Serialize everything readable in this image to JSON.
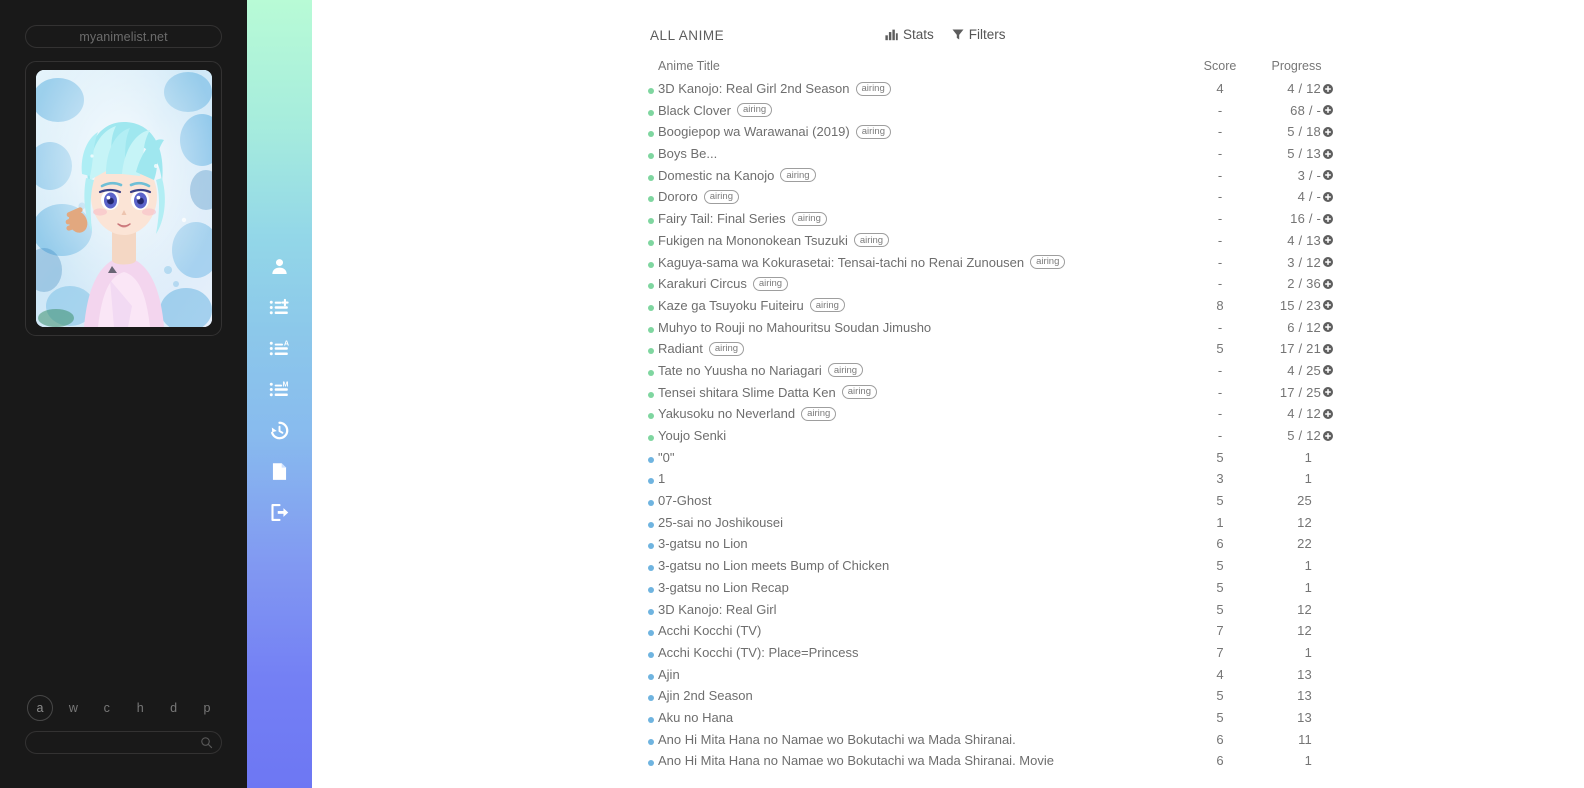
{
  "left": {
    "site_label": "myanimelist.net",
    "avatar_name": "anime-avatar-illustration",
    "letters": [
      {
        "key": "a",
        "label": "a",
        "active": true
      },
      {
        "key": "w",
        "label": "w",
        "active": false
      },
      {
        "key": "c",
        "label": "c",
        "active": false
      },
      {
        "key": "h",
        "label": "h",
        "active": false
      },
      {
        "key": "d",
        "label": "d",
        "active": false
      },
      {
        "key": "p",
        "label": "p",
        "active": false
      }
    ],
    "search": {
      "value": "",
      "placeholder": ""
    }
  },
  "rail": {
    "items": [
      {
        "icon": "user-icon"
      },
      {
        "icon": "list-add-icon"
      },
      {
        "icon": "list-anime-icon"
      },
      {
        "icon": "list-manga-icon"
      },
      {
        "icon": "history-icon"
      },
      {
        "icon": "document-icon"
      },
      {
        "icon": "logout-icon"
      }
    ]
  },
  "main": {
    "list_title": "ALL ANIME",
    "stats_label": "Stats",
    "filters_label": "Filters",
    "columns": {
      "title": "Anime Title",
      "score": "Score",
      "progress": "Progress"
    },
    "colors": {
      "watching_dot": "#7fd6a0",
      "completed_dot": "#6fb4e0",
      "gradient_start": "#b8fbd6",
      "gradient_end": "#6d77f3",
      "page_background": "#191919",
      "content_background": "#ffffff"
    },
    "rows": [
      {
        "status": "watching",
        "title": "3D Kanojo: Real Girl 2nd Season",
        "badge": "airing",
        "score": "4",
        "progress": "4 / 12",
        "increment": true
      },
      {
        "status": "watching",
        "title": "Black Clover",
        "badge": "airing",
        "score": "-",
        "progress": "68 / -",
        "increment": true
      },
      {
        "status": "watching",
        "title": "Boogiepop wa Warawanai (2019)",
        "badge": "airing",
        "score": "-",
        "progress": "5 / 18",
        "increment": true
      },
      {
        "status": "watching",
        "title": "Boys Be...",
        "badge": "",
        "score": "-",
        "progress": "5 / 13",
        "increment": true
      },
      {
        "status": "watching",
        "title": "Domestic na Kanojo",
        "badge": "airing",
        "score": "-",
        "progress": "3 / -",
        "increment": true
      },
      {
        "status": "watching",
        "title": "Dororo",
        "badge": "airing",
        "score": "-",
        "progress": "4 / -",
        "increment": true
      },
      {
        "status": "watching",
        "title": "Fairy Tail: Final Series",
        "badge": "airing",
        "score": "-",
        "progress": "16 / -",
        "increment": true
      },
      {
        "status": "watching",
        "title": "Fukigen na Mononokean Tsuzuki",
        "badge": "airing",
        "score": "-",
        "progress": "4 / 13",
        "increment": true
      },
      {
        "status": "watching",
        "title": "Kaguya-sama wa Kokurasetai: Tensai-tachi no Renai Zunousen",
        "badge": "airing",
        "score": "-",
        "progress": "3 / 12",
        "increment": true
      },
      {
        "status": "watching",
        "title": "Karakuri Circus",
        "badge": "airing",
        "score": "-",
        "progress": "2 / 36",
        "increment": true
      },
      {
        "status": "watching",
        "title": "Kaze ga Tsuyoku Fuiteiru",
        "badge": "airing",
        "score": "8",
        "progress": "15 / 23",
        "increment": true
      },
      {
        "status": "watching",
        "title": "Muhyo to Rouji no Mahouritsu Soudan Jimusho",
        "badge": "",
        "score": "-",
        "progress": "6 / 12",
        "increment": true
      },
      {
        "status": "watching",
        "title": "Radiant",
        "badge": "airing",
        "score": "5",
        "progress": "17 / 21",
        "increment": true
      },
      {
        "status": "watching",
        "title": "Tate no Yuusha no Nariagari",
        "badge": "airing",
        "score": "-",
        "progress": "4 / 25",
        "increment": true
      },
      {
        "status": "watching",
        "title": "Tensei shitara Slime Datta Ken",
        "badge": "airing",
        "score": "-",
        "progress": "17 / 25",
        "increment": true
      },
      {
        "status": "watching",
        "title": "Yakusoku no Neverland",
        "badge": "airing",
        "score": "-",
        "progress": "4 / 12",
        "increment": true
      },
      {
        "status": "watching",
        "title": "Youjo Senki",
        "badge": "",
        "score": "-",
        "progress": "5 / 12",
        "increment": true
      },
      {
        "status": "completed",
        "title": "\"0\"",
        "badge": "",
        "score": "5",
        "progress": "1",
        "increment": false
      },
      {
        "status": "completed",
        "title": "1",
        "badge": "",
        "score": "3",
        "progress": "1",
        "increment": false
      },
      {
        "status": "completed",
        "title": "07-Ghost",
        "badge": "",
        "score": "5",
        "progress": "25",
        "increment": false
      },
      {
        "status": "completed",
        "title": "25-sai no Joshikousei",
        "badge": "",
        "score": "1",
        "progress": "12",
        "increment": false
      },
      {
        "status": "completed",
        "title": "3-gatsu no Lion",
        "badge": "",
        "score": "6",
        "progress": "22",
        "increment": false
      },
      {
        "status": "completed",
        "title": "3-gatsu no Lion meets Bump of Chicken",
        "badge": "",
        "score": "5",
        "progress": "1",
        "increment": false
      },
      {
        "status": "completed",
        "title": "3-gatsu no Lion Recap",
        "badge": "",
        "score": "5",
        "progress": "1",
        "increment": false
      },
      {
        "status": "completed",
        "title": "3D Kanojo: Real Girl",
        "badge": "",
        "score": "5",
        "progress": "12",
        "increment": false
      },
      {
        "status": "completed",
        "title": "Acchi Kocchi (TV)",
        "badge": "",
        "score": "7",
        "progress": "12",
        "increment": false
      },
      {
        "status": "completed",
        "title": "Acchi Kocchi (TV): Place=Princess",
        "badge": "",
        "score": "7",
        "progress": "1",
        "increment": false
      },
      {
        "status": "completed",
        "title": "Ajin",
        "badge": "",
        "score": "4",
        "progress": "13",
        "increment": false
      },
      {
        "status": "completed",
        "title": "Ajin 2nd Season",
        "badge": "",
        "score": "5",
        "progress": "13",
        "increment": false
      },
      {
        "status": "completed",
        "title": "Aku no Hana",
        "badge": "",
        "score": "5",
        "progress": "13",
        "increment": false
      },
      {
        "status": "completed",
        "title": "Ano Hi Mita Hana no Namae wo Bokutachi wa Mada Shiranai.",
        "badge": "",
        "score": "6",
        "progress": "11",
        "increment": false
      },
      {
        "status": "completed",
        "title": "Ano Hi Mita Hana no Namae wo Bokutachi wa Mada Shiranai. Movie",
        "badge": "",
        "score": "6",
        "progress": "1",
        "increment": false
      }
    ]
  }
}
